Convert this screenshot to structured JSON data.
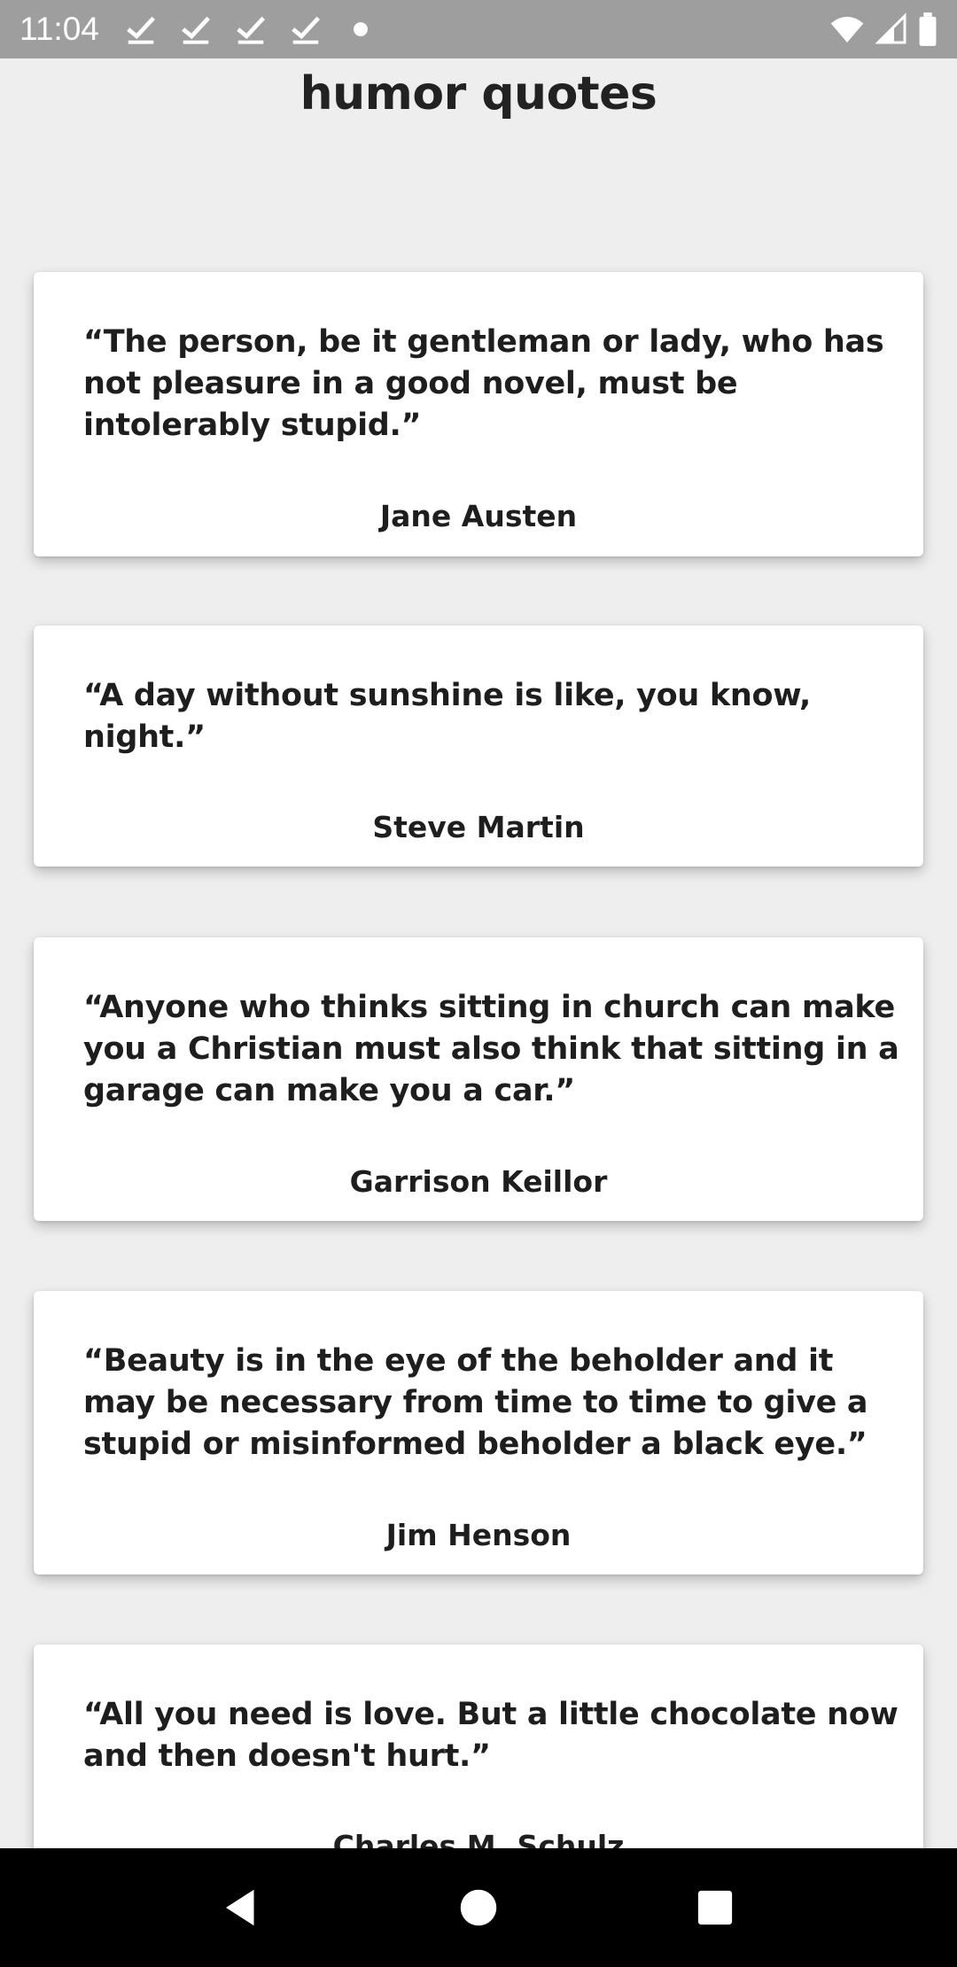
{
  "status_bar": {
    "time": "11:04",
    "left_icons": [
      "check-notification-icon",
      "check-notification-icon",
      "check-notification-icon",
      "check-notification-icon",
      "dot-icon"
    ],
    "right_icons": [
      "wifi-icon",
      "cellular-signal-icon",
      "battery-icon"
    ]
  },
  "page": {
    "title": "humor quotes"
  },
  "quotes": [
    {
      "text": "“The person, be it gentleman or lady, who has not pleasure in a good novel, must be intolerably stupid.”",
      "author": "Jane Austen"
    },
    {
      "text": "“A day without sunshine is like, you know, night.”",
      "author": "Steve Martin"
    },
    {
      "text": "“Anyone who thinks sitting in church can make you a Christian must also think that sitting in a garage can make you a car.”",
      "author": "Garrison Keillor"
    },
    {
      "text": "“Beauty is in the eye of the beholder and it may be necessary from time to time to give a stupid or misinformed beholder a black eye.”",
      "author": "Jim Henson"
    },
    {
      "text": "“All you need is love. But a little chocolate now and then doesn't hurt.”",
      "author": "Charles M. Schulz"
    }
  ],
  "nav_bar": {
    "buttons": [
      "back-icon",
      "home-icon",
      "recents-icon"
    ]
  },
  "colors": {
    "background": "#eeeeee",
    "card": "#ffffff",
    "status_bar": "#9e9e9e",
    "nav_bar": "#000000",
    "text": "#1e1e1e"
  }
}
